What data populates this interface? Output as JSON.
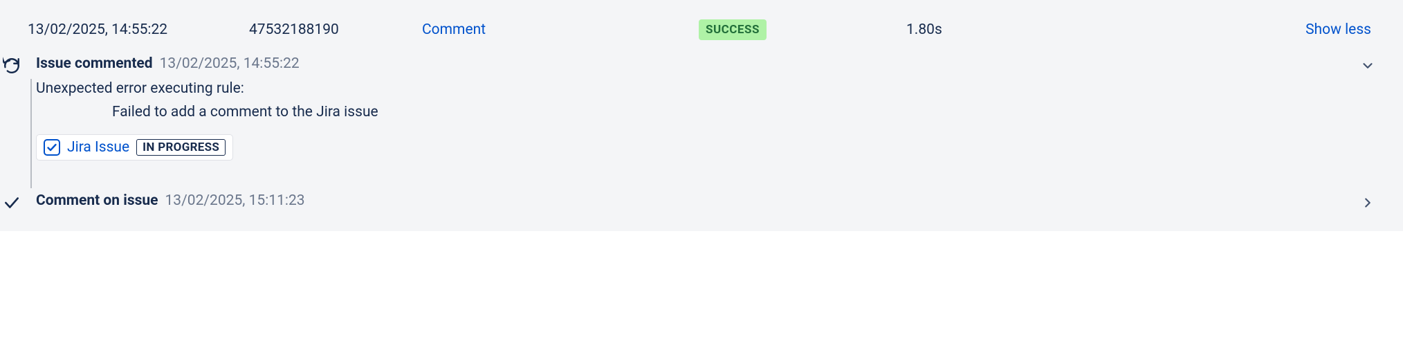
{
  "row": {
    "timestamp": "13/02/2025, 14:55:22",
    "run_id": "47532188190",
    "rule_name": "Comment",
    "status": "SUCCESS",
    "duration": "1.80s",
    "toggle": "Show less"
  },
  "steps": [
    {
      "title": "Issue commented",
      "timestamp": "13/02/2025, 14:55:22",
      "error_line": "Unexpected error executing rule:",
      "error_detail": "Failed to add a comment to the Jira issue",
      "issue": {
        "label": "Jira Issue",
        "status": "IN PROGRESS"
      }
    },
    {
      "title": "Comment on issue",
      "timestamp": "13/02/2025, 15:11:23"
    }
  ]
}
